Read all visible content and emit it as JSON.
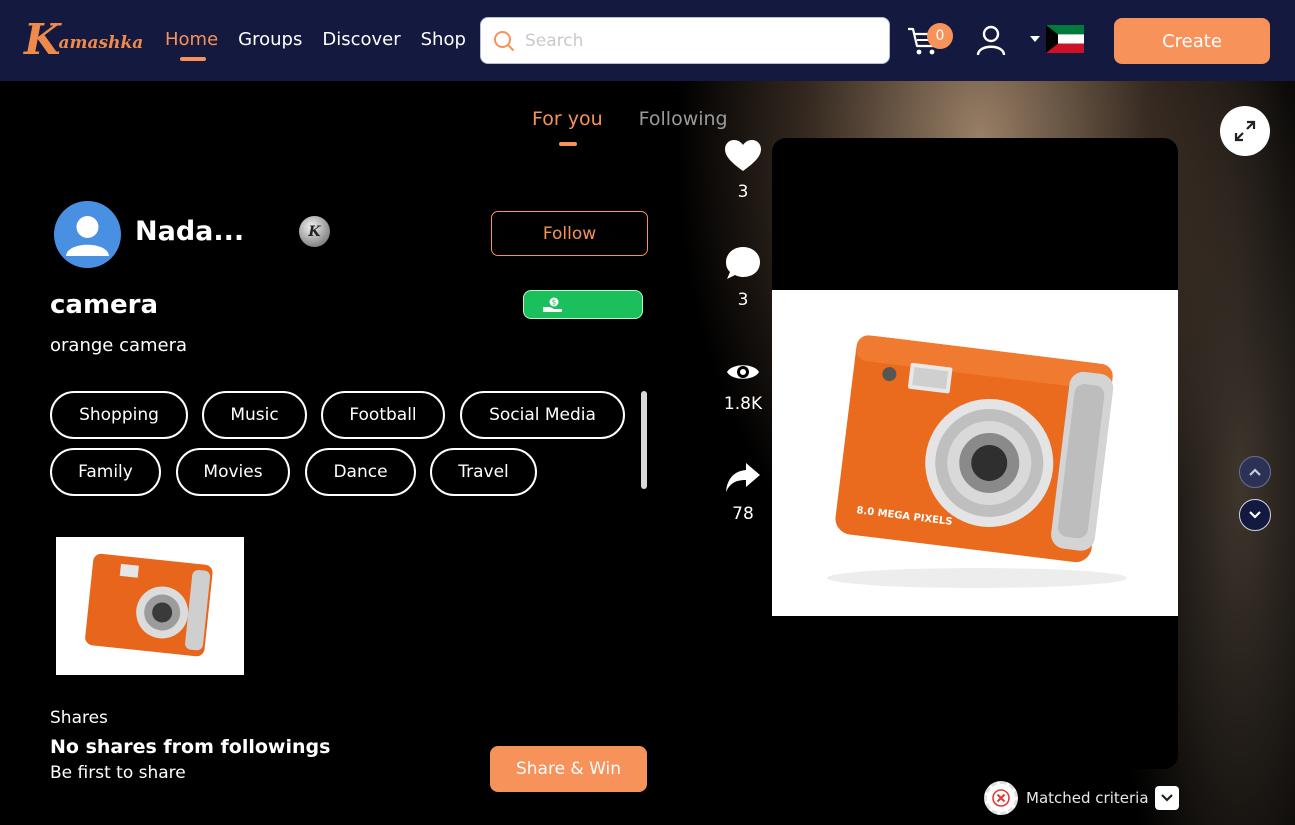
{
  "brand": {
    "name": "Kamashka",
    "initial": "K",
    "rest": "amashka"
  },
  "nav": [
    {
      "label": "Home",
      "active": true
    },
    {
      "label": "Groups"
    },
    {
      "label": "Discover"
    },
    {
      "label": "Shop"
    }
  ],
  "search": {
    "placeholder": "Search",
    "value": ""
  },
  "cart": {
    "count": "0"
  },
  "language": {
    "flag": "Kuwait"
  },
  "create_label": "Create",
  "feed_tabs": [
    {
      "label": "For you",
      "active": true
    },
    {
      "label": "Following"
    }
  ],
  "post": {
    "author": "Nada...",
    "badge": "K",
    "follow_label": "Follow",
    "title": "camera",
    "description": "orange camera",
    "tags": [
      "Shopping",
      "Music",
      "Football",
      "Social Media",
      "Family",
      "Movies",
      "Dance",
      "Travel"
    ],
    "image_alt": "orange camera",
    "camera_text": "8.0 MEGA PIXELS"
  },
  "shares": {
    "label": "Shares",
    "empty": "No shares from followings",
    "sub": "Be first to share",
    "button": "Share & Win"
  },
  "actions": {
    "likes": "3",
    "comments": "3",
    "views": "1.8K",
    "shares": "78"
  },
  "matched": {
    "label": "Matched criteria"
  },
  "colors": {
    "accent": "#f7925a",
    "nav_bg": "#14193f",
    "green": "#1bbf5c"
  }
}
